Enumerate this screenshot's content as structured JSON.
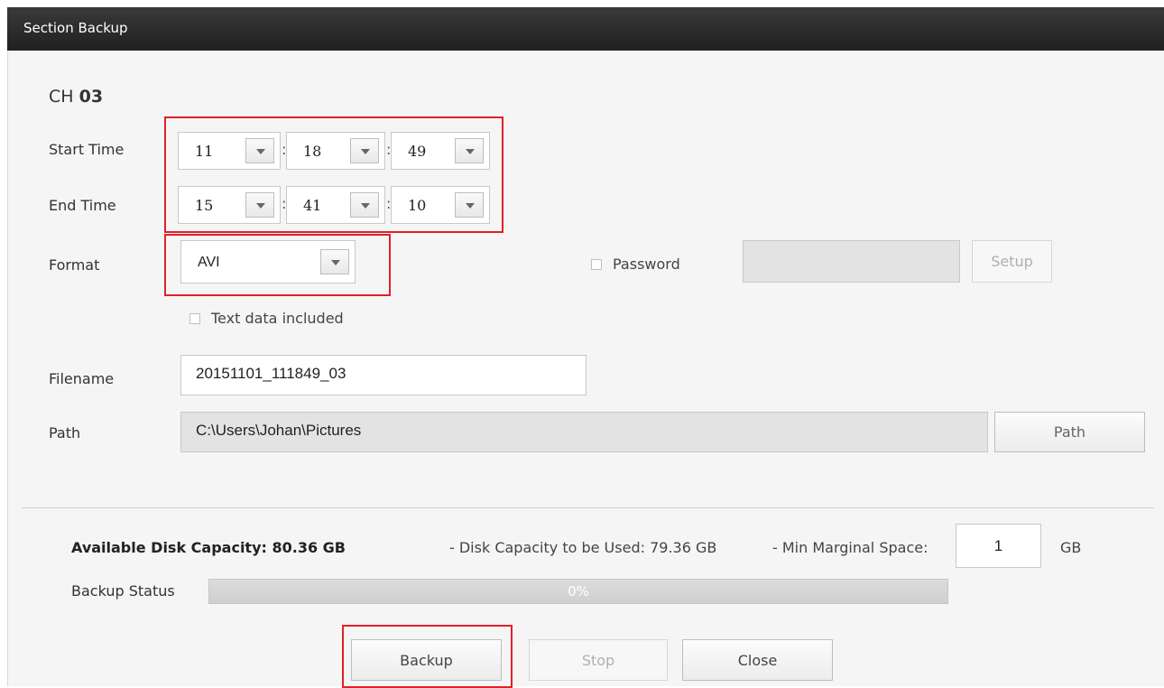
{
  "window": {
    "title": "Section Backup"
  },
  "channel": {
    "prefix": "CH",
    "number": "03"
  },
  "start_time": {
    "label": "Start Time",
    "hour": "11",
    "minute": "18",
    "second": "49"
  },
  "end_time": {
    "label": "End Time",
    "hour": "15",
    "minute": "41",
    "second": "10"
  },
  "time_separator": ":",
  "format": {
    "label": "Format",
    "value": "AVI"
  },
  "password": {
    "label": "Password",
    "checked": false,
    "value": "",
    "setup_label": "Setup"
  },
  "text_data": {
    "label": "Text data included",
    "checked": false
  },
  "filename": {
    "label": "Filename",
    "value": "20151101_111849_03"
  },
  "path": {
    "label": "Path",
    "value": "C:\\Users\\Johan\\Pictures",
    "button_label": "Path"
  },
  "disk": {
    "available": "Available Disk Capacity: 80.36 GB",
    "to_be_used": "- Disk Capacity to be Used: 79.36 GB",
    "min_margin_label": "- Min Marginal Space:",
    "min_margin_value": "1",
    "min_margin_unit": "GB"
  },
  "backup_status": {
    "label": "Backup Status",
    "progress": 0,
    "progress_text": "0%"
  },
  "buttons": {
    "backup": "Backup",
    "stop": "Stop",
    "close": "Close"
  },
  "colors": {
    "highlight_red": "#e0202a",
    "titlebar": "#2a2a2a",
    "background": "#f5f5f5"
  }
}
